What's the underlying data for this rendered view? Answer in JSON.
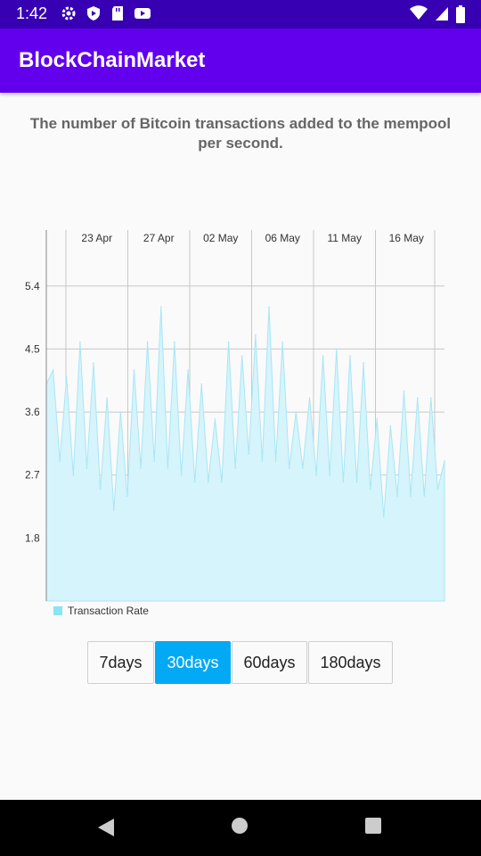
{
  "status_bar": {
    "time": "1:42",
    "left_icons": [
      "gear-icon",
      "play-protect-icon",
      "sd-card-icon",
      "youtube-icon"
    ],
    "right_icons": [
      "wifi-icon",
      "signal-icon",
      "battery-icon"
    ]
  },
  "app_bar": {
    "title": "BlockChainMarket",
    "color": "#6200ee"
  },
  "chart_title": "The number of Bitcoin transactions added to the mempool per second.",
  "buttons": [
    {
      "label": "7days",
      "active": false
    },
    {
      "label": "30days",
      "active": true
    },
    {
      "label": "60days",
      "active": false
    },
    {
      "label": "180days",
      "active": false
    }
  ],
  "chart_data": {
    "type": "area",
    "title": "The number of Bitcoin transactions added to the mempool per second.",
    "xlabel": "",
    "ylabel": "",
    "x_tick_labels": [
      "23 Apr",
      "27 Apr",
      "02 May",
      "06 May",
      "11 May",
      "16 May"
    ],
    "y_tick_labels": [
      "1.8",
      "2.7",
      "3.6",
      "4.5",
      "5.4"
    ],
    "y_ticks": [
      1.8,
      2.7,
      3.6,
      4.5,
      5.4
    ],
    "ylim": [
      0.9,
      6.2
    ],
    "fill_color": "#d6f4fb",
    "line_color": "#a8e6f5",
    "legend_position": "bottom-left",
    "grid": true,
    "series": [
      {
        "name": "Transaction Rate",
        "values": [
          4.0,
          4.2,
          2.9,
          4.1,
          2.7,
          4.6,
          2.8,
          4.3,
          2.5,
          3.8,
          2.2,
          3.6,
          2.4,
          4.2,
          2.8,
          4.6,
          2.9,
          5.1,
          2.8,
          4.6,
          2.7,
          4.2,
          2.6,
          4.0,
          2.6,
          3.5,
          2.6,
          4.6,
          2.8,
          4.4,
          3.0,
          4.7,
          2.9,
          5.1,
          2.9,
          4.6,
          2.8,
          3.6,
          2.8,
          3.8,
          2.7,
          4.4,
          2.7,
          4.5,
          2.6,
          4.4,
          2.6,
          4.3,
          2.5,
          3.5,
          2.1,
          3.4,
          2.4,
          3.9,
          2.4,
          3.8,
          2.4,
          3.8,
          2.5,
          2.9
        ]
      }
    ]
  }
}
